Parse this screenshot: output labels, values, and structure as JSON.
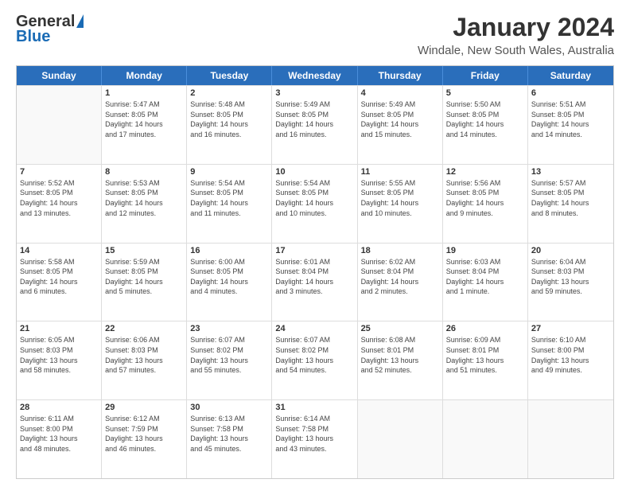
{
  "header": {
    "logo_general": "General",
    "logo_blue": "Blue",
    "title": "January 2024",
    "location": "Windale, New South Wales, Australia"
  },
  "weekdays": [
    "Sunday",
    "Monday",
    "Tuesday",
    "Wednesday",
    "Thursday",
    "Friday",
    "Saturday"
  ],
  "weeks": [
    [
      {
        "day": "",
        "info": ""
      },
      {
        "day": "1",
        "info": "Sunrise: 5:47 AM\nSunset: 8:05 PM\nDaylight: 14 hours\nand 17 minutes."
      },
      {
        "day": "2",
        "info": "Sunrise: 5:48 AM\nSunset: 8:05 PM\nDaylight: 14 hours\nand 16 minutes."
      },
      {
        "day": "3",
        "info": "Sunrise: 5:49 AM\nSunset: 8:05 PM\nDaylight: 14 hours\nand 16 minutes."
      },
      {
        "day": "4",
        "info": "Sunrise: 5:49 AM\nSunset: 8:05 PM\nDaylight: 14 hours\nand 15 minutes."
      },
      {
        "day": "5",
        "info": "Sunrise: 5:50 AM\nSunset: 8:05 PM\nDaylight: 14 hours\nand 14 minutes."
      },
      {
        "day": "6",
        "info": "Sunrise: 5:51 AM\nSunset: 8:05 PM\nDaylight: 14 hours\nand 14 minutes."
      }
    ],
    [
      {
        "day": "7",
        "info": "Sunrise: 5:52 AM\nSunset: 8:05 PM\nDaylight: 14 hours\nand 13 minutes."
      },
      {
        "day": "8",
        "info": "Sunrise: 5:53 AM\nSunset: 8:05 PM\nDaylight: 14 hours\nand 12 minutes."
      },
      {
        "day": "9",
        "info": "Sunrise: 5:54 AM\nSunset: 8:05 PM\nDaylight: 14 hours\nand 11 minutes."
      },
      {
        "day": "10",
        "info": "Sunrise: 5:54 AM\nSunset: 8:05 PM\nDaylight: 14 hours\nand 10 minutes."
      },
      {
        "day": "11",
        "info": "Sunrise: 5:55 AM\nSunset: 8:05 PM\nDaylight: 14 hours\nand 10 minutes."
      },
      {
        "day": "12",
        "info": "Sunrise: 5:56 AM\nSunset: 8:05 PM\nDaylight: 14 hours\nand 9 minutes."
      },
      {
        "day": "13",
        "info": "Sunrise: 5:57 AM\nSunset: 8:05 PM\nDaylight: 14 hours\nand 8 minutes."
      }
    ],
    [
      {
        "day": "14",
        "info": "Sunrise: 5:58 AM\nSunset: 8:05 PM\nDaylight: 14 hours\nand 6 minutes."
      },
      {
        "day": "15",
        "info": "Sunrise: 5:59 AM\nSunset: 8:05 PM\nDaylight: 14 hours\nand 5 minutes."
      },
      {
        "day": "16",
        "info": "Sunrise: 6:00 AM\nSunset: 8:05 PM\nDaylight: 14 hours\nand 4 minutes."
      },
      {
        "day": "17",
        "info": "Sunrise: 6:01 AM\nSunset: 8:04 PM\nDaylight: 14 hours\nand 3 minutes."
      },
      {
        "day": "18",
        "info": "Sunrise: 6:02 AM\nSunset: 8:04 PM\nDaylight: 14 hours\nand 2 minutes."
      },
      {
        "day": "19",
        "info": "Sunrise: 6:03 AM\nSunset: 8:04 PM\nDaylight: 14 hours\nand 1 minute."
      },
      {
        "day": "20",
        "info": "Sunrise: 6:04 AM\nSunset: 8:03 PM\nDaylight: 13 hours\nand 59 minutes."
      }
    ],
    [
      {
        "day": "21",
        "info": "Sunrise: 6:05 AM\nSunset: 8:03 PM\nDaylight: 13 hours\nand 58 minutes."
      },
      {
        "day": "22",
        "info": "Sunrise: 6:06 AM\nSunset: 8:03 PM\nDaylight: 13 hours\nand 57 minutes."
      },
      {
        "day": "23",
        "info": "Sunrise: 6:07 AM\nSunset: 8:02 PM\nDaylight: 13 hours\nand 55 minutes."
      },
      {
        "day": "24",
        "info": "Sunrise: 6:07 AM\nSunset: 8:02 PM\nDaylight: 13 hours\nand 54 minutes."
      },
      {
        "day": "25",
        "info": "Sunrise: 6:08 AM\nSunset: 8:01 PM\nDaylight: 13 hours\nand 52 minutes."
      },
      {
        "day": "26",
        "info": "Sunrise: 6:09 AM\nSunset: 8:01 PM\nDaylight: 13 hours\nand 51 minutes."
      },
      {
        "day": "27",
        "info": "Sunrise: 6:10 AM\nSunset: 8:00 PM\nDaylight: 13 hours\nand 49 minutes."
      }
    ],
    [
      {
        "day": "28",
        "info": "Sunrise: 6:11 AM\nSunset: 8:00 PM\nDaylight: 13 hours\nand 48 minutes."
      },
      {
        "day": "29",
        "info": "Sunrise: 6:12 AM\nSunset: 7:59 PM\nDaylight: 13 hours\nand 46 minutes."
      },
      {
        "day": "30",
        "info": "Sunrise: 6:13 AM\nSunset: 7:58 PM\nDaylight: 13 hours\nand 45 minutes."
      },
      {
        "day": "31",
        "info": "Sunrise: 6:14 AM\nSunset: 7:58 PM\nDaylight: 13 hours\nand 43 minutes."
      },
      {
        "day": "",
        "info": ""
      },
      {
        "day": "",
        "info": ""
      },
      {
        "day": "",
        "info": ""
      }
    ]
  ]
}
